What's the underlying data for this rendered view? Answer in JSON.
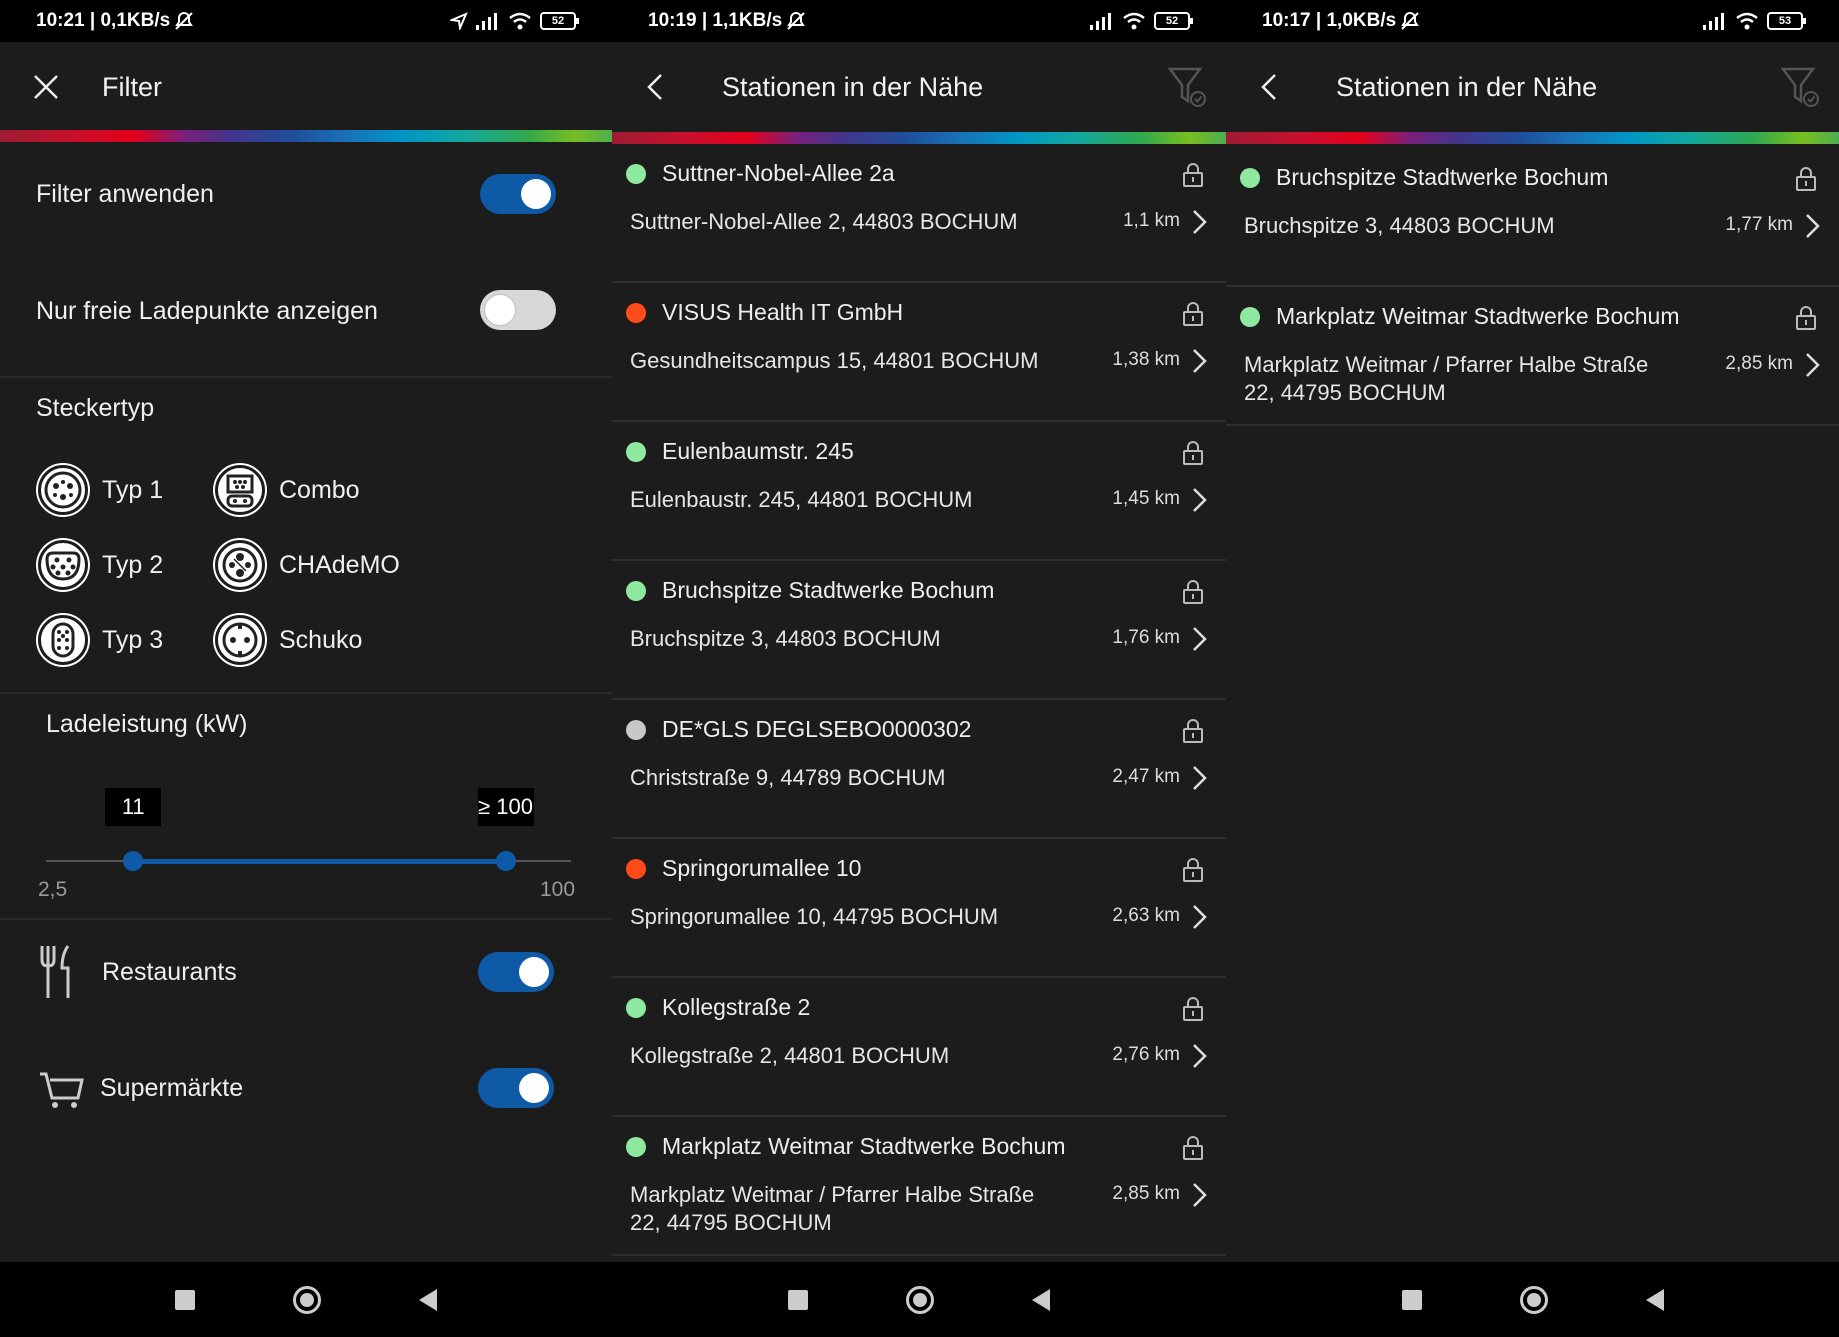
{
  "screen1": {
    "status": {
      "time": "10:21 | 0,1KB/s",
      "battery": "52"
    },
    "title": "Filter",
    "filter_apply_label": "Filter anwenden",
    "free_only_label": "Nur freie Ladepunkte anzeigen",
    "plug_section_title": "Steckertyp",
    "plugs": [
      {
        "label": "Typ 1",
        "icon": "type1-plug-icon"
      },
      {
        "label": "Combo",
        "icon": "combo-plug-icon"
      },
      {
        "label": "Typ 2",
        "icon": "type2-plug-icon"
      },
      {
        "label": "CHAdeMO",
        "icon": "chademo-plug-icon"
      },
      {
        "label": "Typ 3",
        "icon": "type3-plug-icon"
      },
      {
        "label": "Schuko",
        "icon": "schuko-plug-icon"
      }
    ],
    "power_title": "Ladeleistung (kW)",
    "slider": {
      "min_label": "2,5",
      "max_label": "100",
      "low_value": "11",
      "high_value": "≥ 100",
      "low_fraction": 0.37,
      "high_fraction": 1.0
    },
    "restaurants_label": "Restaurants",
    "supermarkets_label": "Supermärkte",
    "toggles": {
      "filter_apply": true,
      "free_only": false,
      "restaurants": true,
      "supermarkets": true
    }
  },
  "screen2": {
    "status": {
      "time": "10:19 | 1,1KB/s",
      "battery": "52"
    },
    "title": "Stationen in der Nähe",
    "stations": [
      {
        "name": "Suttner-Nobel-Allee 2a",
        "address": "Suttner-Nobel-Allee 2, 44803 BOCHUM",
        "distance": "1,1 km",
        "status_color": "#8ee8a0"
      },
      {
        "name": "VISUS Health IT GmbH",
        "address": "Gesundheitscampus 15, 44801 BOCHUM",
        "distance": "1,38 km",
        "status_color": "#ff4a1a"
      },
      {
        "name": "Eulenbaumstr. 245",
        "address": "Eulenbaustr. 245, 44801 BOCHUM",
        "distance": "1,45 km",
        "status_color": "#8ee8a0"
      },
      {
        "name": "Bruchspitze  Stadtwerke Bochum",
        "address": "Bruchspitze 3, 44803 BOCHUM",
        "distance": "1,76 km",
        "status_color": "#8ee8a0"
      },
      {
        "name": "DE*GLS DEGLSEBO0000302",
        "address": "Christstraße 9, 44789 BOCHUM",
        "distance": "2,47 km",
        "status_color": "#c8c8c8"
      },
      {
        "name": "Springorumallee 10",
        "address": "Springorumallee 10, 44795 BOCHUM",
        "distance": "2,63 km",
        "status_color": "#ff4a1a"
      },
      {
        "name": "Kollegstraße 2",
        "address": "Kollegstraße 2, 44801 BOCHUM",
        "distance": "2,76 km",
        "status_color": "#8ee8a0"
      },
      {
        "name": "Markplatz Weitmar  Stadtwerke Bochum",
        "address": "Markplatz Weitmar / Pfarrer Halbe Straße 22, 44795 BOCHUM",
        "distance": "2,85 km",
        "status_color": "#8ee8a0"
      }
    ]
  },
  "screen3": {
    "status": {
      "time": "10:17 | 1,0KB/s",
      "battery": "53"
    },
    "title": "Stationen in der Nähe",
    "stations": [
      {
        "name": "Bruchspitze  Stadtwerke Bochum",
        "address": "Bruchspitze 3, 44803 BOCHUM",
        "distance": "1,77 km",
        "status_color": "#8ee8a0"
      },
      {
        "name": "Markplatz Weitmar  Stadtwerke Bochum",
        "address": "Markplatz Weitmar / Pfarrer Halbe Straße 22, 44795 BOCHUM",
        "distance": "2,85 km",
        "status_color": "#8ee8a0"
      }
    ]
  },
  "colors": {
    "accent": "#0e5aa7",
    "background": "#1c1c1c",
    "available": "#8ee8a0",
    "occupied": "#ff4a1a",
    "unknown": "#c8c8c8"
  }
}
